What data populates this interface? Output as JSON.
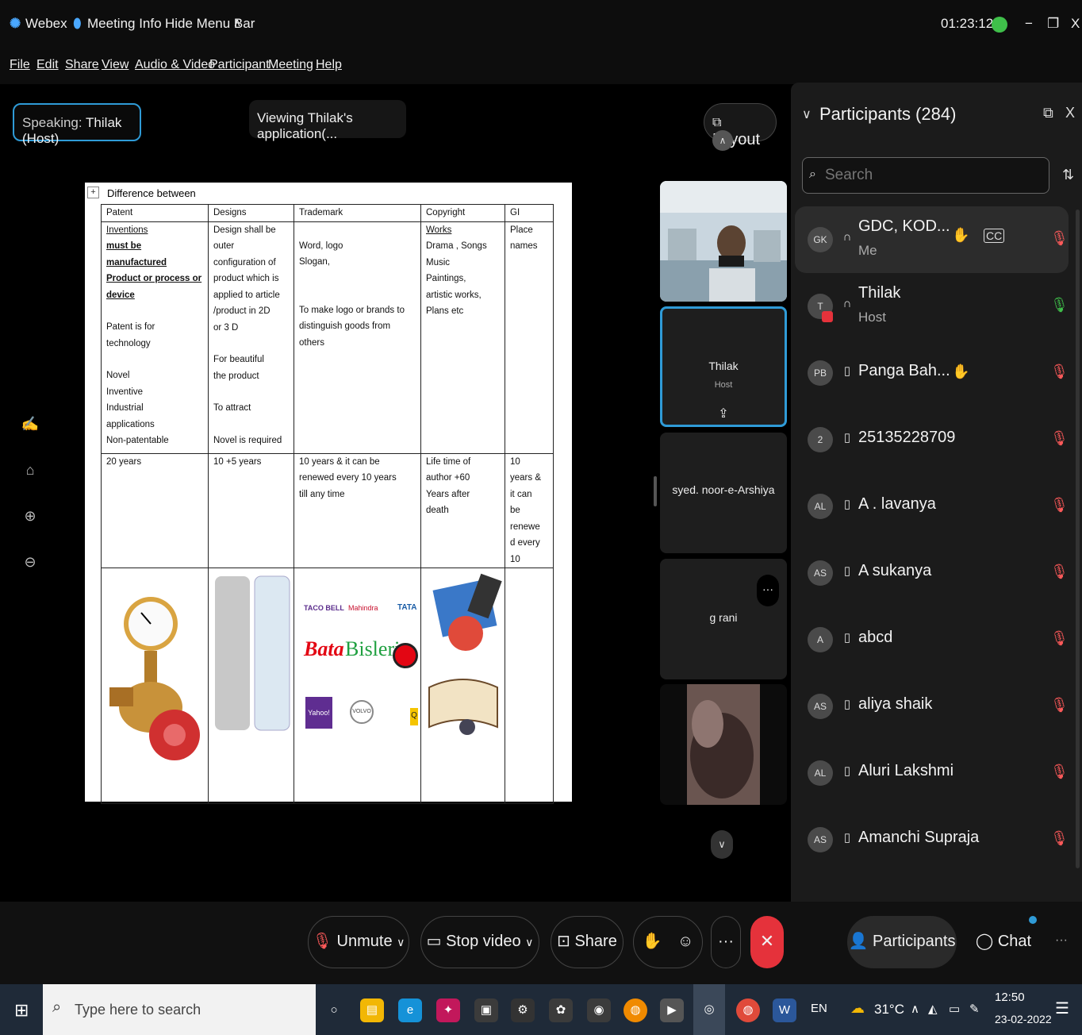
{
  "titlebar": {
    "app_name": "Webex",
    "meeting_info": "Meeting Info",
    "hide_menu_bar": "Hide Menu Bar",
    "timer": "01:23:12"
  },
  "menu": [
    "File",
    "Edit",
    "Share",
    "View",
    "Audio & Video",
    "Participant",
    "Meeting",
    "Help"
  ],
  "stage": {
    "speaking_prefix": "Speaking:",
    "speaking_name": "Thilak (Host)",
    "viewing": "Viewing Thilak's application(...",
    "layout_label": "Layout"
  },
  "document": {
    "heading": "Difference between",
    "headers": [
      "Patent",
      "Designs",
      "Trademark",
      "Copyright",
      "GI"
    ],
    "row1": {
      "patent": [
        "Inventions",
        "must be",
        "manufactured",
        "Product or process or",
        "device",
        "",
        "Patent is for",
        "technology",
        "",
        "Novel",
        "Inventive",
        "Industrial",
        "applications",
        "Non-patentable"
      ],
      "designs": [
        "Design shall be",
        "outer",
        "configuration of",
        "product which is",
        "applied to article",
        "/product in 2D",
        "or 3 D",
        "",
        "For beautiful",
        "the product",
        "",
        "To attract",
        "",
        "Novel is required"
      ],
      "trademark": [
        "",
        "Word, logo",
        "Slogan,",
        "",
        "",
        "To make logo or brands to",
        "distinguish goods from",
        "others"
      ],
      "copyright": [
        "Works",
        "Drama , Songs",
        "Music",
        "Paintings,",
        "artistic works,",
        "Plans etc"
      ],
      "gi": [
        "Place",
        "names"
      ]
    },
    "row2": {
      "patent": [
        "20 years"
      ],
      "designs": [
        "10 +5 years"
      ],
      "trademark": [
        "10 years & it can be",
        "renewed every 10 years",
        "till any time"
      ],
      "copyright": [
        "Life time of",
        "author +60",
        "Years after",
        "death"
      ],
      "gi": [
        "10",
        "years &",
        "it can",
        "be",
        "renewe",
        "d every",
        "10"
      ]
    },
    "logos": [
      "TACO BELL",
      "Mahindra",
      "TATA",
      "Bata",
      "Bisleri",
      "Yahoo!",
      "VOLVO",
      "Q"
    ]
  },
  "tiles": [
    {
      "name": "Thilak",
      "sub": "Host"
    },
    {
      "name": "syed. noor-e-Arshiya"
    },
    {
      "name": "g rani"
    }
  ],
  "panel": {
    "title": "Participants (284)",
    "search_placeholder": "Search",
    "participants": [
      {
        "initials": "GK",
        "name": "GDC, KOD...",
        "sub": "Me"
      },
      {
        "initials": "T",
        "name": "Thilak",
        "sub": "Host"
      },
      {
        "initials": "PB",
        "name": "Panga Bah..."
      },
      {
        "initials": "2",
        "name": "25135228709"
      },
      {
        "initials": "AL",
        "name": "A . lavanya"
      },
      {
        "initials": "AS",
        "name": "A sukanya"
      },
      {
        "initials": "A",
        "name": "abcd"
      },
      {
        "initials": "AS",
        "name": "aliya shaik"
      },
      {
        "initials": "AL",
        "name": "Aluri Lakshmi"
      },
      {
        "initials": "AS",
        "name": "Amanchi Supraja"
      }
    ]
  },
  "controls": {
    "unmute": "Unmute",
    "stop_video": "Stop video",
    "share": "Share",
    "participants": "Participants",
    "chat": "Chat"
  },
  "taskbar": {
    "search_placeholder": "Type here to search",
    "lang": "EN",
    "temperature": "31°C",
    "time": "12:50",
    "date": "23-02-2022"
  },
  "colors": {
    "accent_blue": "#2f9bd7",
    "end_red": "#e5323b",
    "muted_red": "#ff5a5a",
    "unmuted_green": "#3fbf4a"
  }
}
